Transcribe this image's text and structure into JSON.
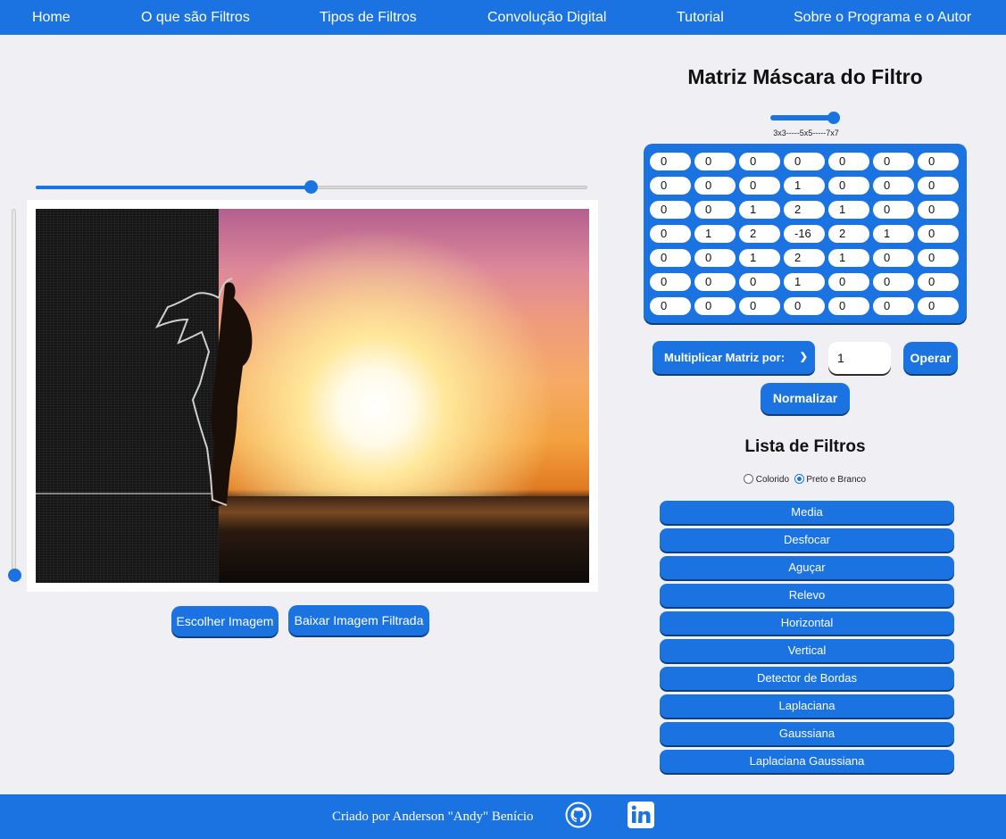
{
  "nav": {
    "items": [
      {
        "label": "Home"
      },
      {
        "label": "O que são Filtros"
      },
      {
        "label": "Tipos de Filtros"
      },
      {
        "label": "Convolução Digital"
      },
      {
        "label": "Tutorial"
      },
      {
        "label": "Sobre o Programa e o Autor"
      }
    ]
  },
  "viewer": {
    "split_position_percent": 50,
    "vertical_slider_percent": 0,
    "choose_button": "Escolher Imagem",
    "download_button": "Baixar Imagem Filtrada"
  },
  "mask": {
    "title": "Matriz Máscara do Filtro",
    "size_scale_label": "3x3-----5x5-----7x7",
    "size_selected": "7x7",
    "rows": [
      [
        "0",
        "0",
        "0",
        "0",
        "0",
        "0",
        "0"
      ],
      [
        "0",
        "0",
        "0",
        "1",
        "0",
        "0",
        "0"
      ],
      [
        "0",
        "0",
        "1",
        "2",
        "1",
        "0",
        "0"
      ],
      [
        "0",
        "1",
        "2",
        "-16",
        "2",
        "1",
        "0"
      ],
      [
        "0",
        "0",
        "1",
        "2",
        "1",
        "0",
        "0"
      ],
      [
        "0",
        "0",
        "0",
        "1",
        "0",
        "0",
        "0"
      ],
      [
        "0",
        "0",
        "0",
        "0",
        "0",
        "0",
        "0"
      ]
    ],
    "operation_select": "Multiplicar Matriz por:",
    "operation_value": "1",
    "operate_button": "Operar",
    "normalize_button": "Normalizar"
  },
  "filters": {
    "title": "Lista de Filtros",
    "mode_options": [
      {
        "label": "Colorido",
        "checked": false
      },
      {
        "label": "Preto e Branco",
        "checked": true
      }
    ],
    "items": [
      "Media",
      "Desfocar",
      "Aguçar",
      "Relevo",
      "Horizontal",
      "Vertical",
      "Detector de Bordas",
      "Laplaciana",
      "Gaussiana",
      "Laplaciana Gaussiana"
    ]
  },
  "footer": {
    "credit": "Criado por Anderson \"Andy\" Benício",
    "github_icon": "github-icon",
    "linkedin_icon": "linkedin-icon"
  },
  "colors": {
    "primary": "#1a73e1",
    "background": "#f0f0f4"
  }
}
